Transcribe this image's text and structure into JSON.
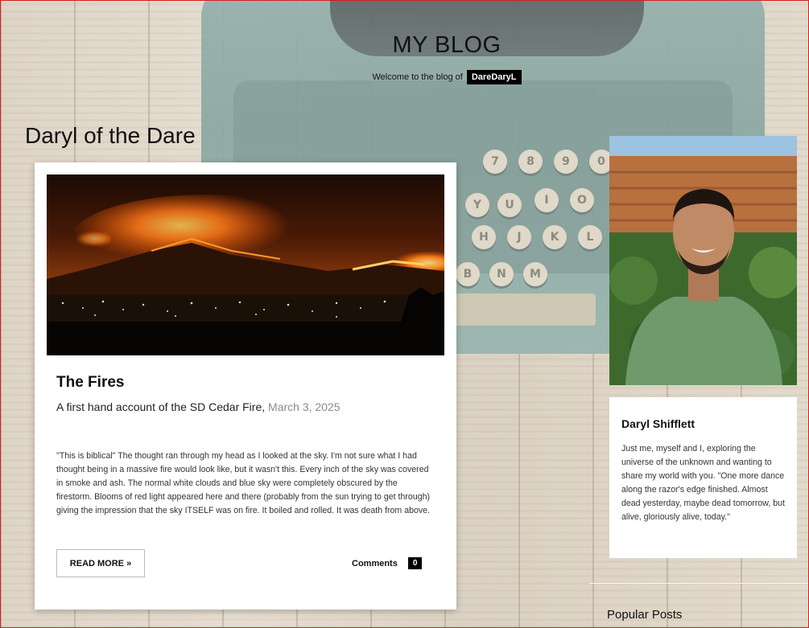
{
  "header": {
    "site_title": "MY BLOG",
    "tagline": "Welcome to the blog of",
    "username": "DareDaryL"
  },
  "blog": {
    "name": "Daryl of the Dare"
  },
  "post": {
    "title": "The Fires",
    "subtitle": "A first hand account of the SD Cedar Fire,",
    "date": "March 3, 2025",
    "excerpt": "\"This is biblical\" The thought ran through my head as I looked at the sky. I'm not sure what I had thought being in a massive fire would look like, but it wasn't this. Every inch of the sky was covered in smoke and ash. The normal white clouds and blue sky were completely obscured by the firestorm. Blooms of red light appeared here and there (probably from the sun trying to get through) giving the impression that the sky ITSELF was on fire. It boiled and rolled. It was death from above.",
    "read_more_label": "READ MORE »",
    "comments_label": "Comments",
    "comments_count": "0"
  },
  "author": {
    "name": "Daryl Shifflett",
    "bio": "Just me, myself and I, exploring the universe of the unknown and wanting to share my world with you. \"One more dance along the razor's edge finished. Almost dead yesterday, maybe dead tomorrow, but alive, gloriously alive, today.\""
  },
  "sidebar": {
    "popular_posts_heading": "Popular Posts"
  },
  "keys": [
    "7",
    "8",
    "9",
    "0",
    "Y",
    "U",
    "I",
    "O",
    "H",
    "J",
    "K",
    "L",
    "B",
    "N",
    "M"
  ],
  "colors": {
    "accent_black": "#000000",
    "frame_border": "#d21f1f",
    "date_gray": "#8a8a8a"
  }
}
